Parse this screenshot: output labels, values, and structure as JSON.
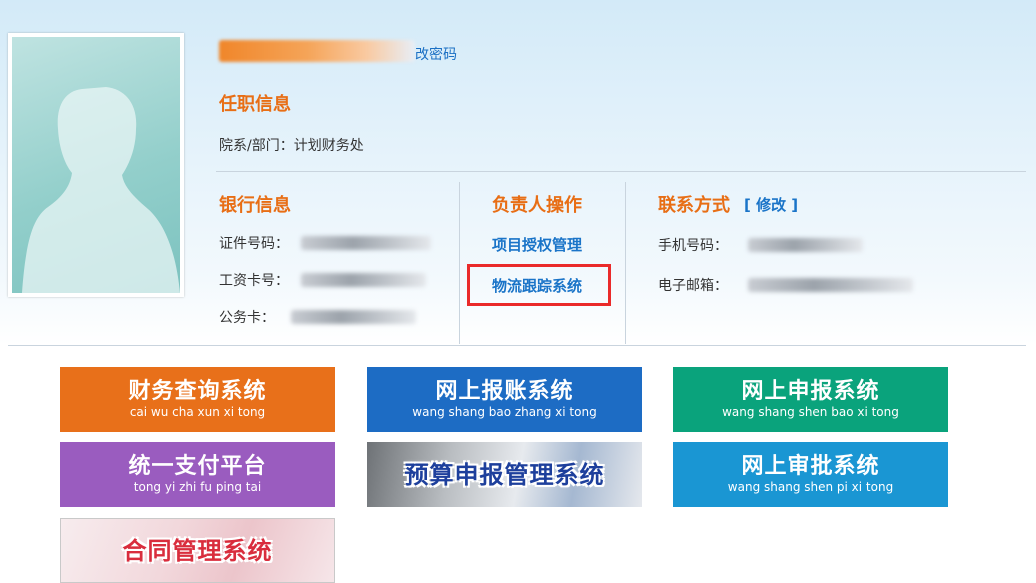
{
  "profile": {
    "change_password": "改密码"
  },
  "job_info": {
    "title": "任职信息",
    "department": "院系/部门：计划财务处"
  },
  "bank_info": {
    "title": "银行信息",
    "id_number_label": "证件号码：",
    "salary_card_label": "工资卡号：",
    "official_card_label": "公务卡："
  },
  "manager_ops": {
    "title": "负责人操作",
    "project_auth": "项目授权管理",
    "logistics": "物流跟踪系统"
  },
  "contact": {
    "title": "联系方式",
    "edit": "[ 修改 ]",
    "mobile_label": "手机号码：",
    "email_label": "电子邮箱："
  },
  "tiles": [
    {
      "cn": "财务查询系统",
      "py": "cai wu cha xun xi tong",
      "color": "#e8701a"
    },
    {
      "cn": "网上报账系统",
      "py": "wang shang bao zhang xi tong",
      "color": "#1d6cc4"
    },
    {
      "cn": "网上申报系统",
      "py": "wang shang shen bao xi tong",
      "color": "#0aa37c"
    },
    {
      "cn": "统一支付平台",
      "py": "tong yi zhi fu ping tai",
      "color": "#9a5cbf"
    },
    {
      "cn": "预算申报管理系统"
    },
    {
      "cn": "网上审批系统",
      "py": "wang shang shen pi xi tong",
      "color": "#1a96d3"
    },
    {
      "cn": "合同管理系统"
    }
  ],
  "colors": {
    "accent_orange": "#e86e15",
    "link_blue": "#1a74c8",
    "highlight_red": "#ea2a2a"
  }
}
